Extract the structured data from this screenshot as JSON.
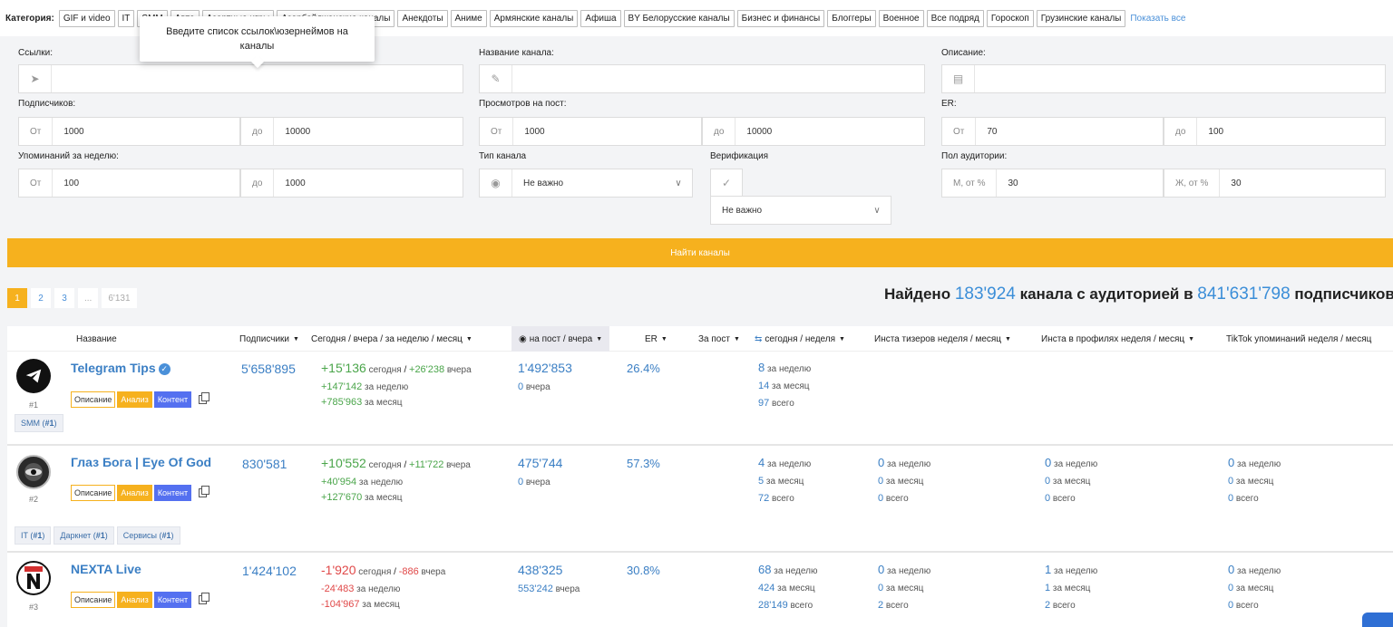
{
  "categories": {
    "label": "Категория:",
    "items": [
      "GIF и video",
      "IT",
      "SMM",
      "Авто",
      "Азартные игры",
      "Азербайджанские каналы",
      "Анекдоты",
      "Аниме",
      "Армянские каналы",
      "Афиша",
      "BY Белорусские каналы",
      "Бизнес и финансы",
      "Блоггеры",
      "Военное",
      "Все подряд",
      "Гороскоп",
      "Грузинские каналы"
    ],
    "show_all": "Показать все"
  },
  "tooltip": "Введите список ссылок\\юзернеймов на каналы",
  "filters": {
    "links_label": "Ссылки:",
    "name_label": "Название канала:",
    "desc_label": "Описание:",
    "subs_label": "Подписчиков:",
    "subs_from": "1000",
    "subs_to": "10000",
    "views_label": "Просмотров на пост:",
    "views_from": "1000",
    "views_to": "10000",
    "er_label": "ER:",
    "er_from": "70",
    "er_to": "100",
    "mentions_label": "Упоминаний за неделю:",
    "mentions_from": "100",
    "mentions_to": "1000",
    "type_label": "Тип канала",
    "type_value": "Не важно",
    "verif_label": "Верификация",
    "verif_value": "Не важно",
    "gender_label": "Пол аудитории:",
    "male_prefix": "М, от %",
    "male_value": "30",
    "female_prefix": "Ж, от %",
    "female_value": "30",
    "from": "От",
    "to": "до",
    "find_button": "Найти каналы"
  },
  "pagination": [
    "1",
    "2",
    "3",
    "...",
    "6'131"
  ],
  "found": {
    "prefix": "Найдено",
    "channels": "183'924",
    "middle": "канала с аудиторией в",
    "audience": "841'631'798",
    "suffix": "подписчиков"
  },
  "columns": {
    "name": "Название",
    "subs": "Подписчики",
    "growth": "Сегодня / вчера / за неделю / месяц",
    "views": "на пост / вчера",
    "er": "ER",
    "per_post": "За пост",
    "reposts": "сегодня / неделя",
    "insta_teasers": "Инста тизеров неделя / месяц",
    "insta_profiles": "Инста в профилях неделя / месяц",
    "tiktok": "TikTok упоминаний неделя / месяц"
  },
  "buttons": {
    "desc": "Описание",
    "analysis": "Анализ",
    "content": "Контент"
  },
  "words": {
    "today": "сегодня",
    "yesterday": "вчера",
    "per_week": "за неделю",
    "per_month": "за месяц",
    "total": "всего"
  },
  "rows": [
    {
      "name": "Telegram Tips",
      "rank": "#1",
      "subs": "5'658'895",
      "today": "+15'136",
      "yday": "+26'238",
      "week": "+147'142",
      "month": "+785'963",
      "views": "1'492'853",
      "views_yday": "0",
      "er": "26.4%",
      "rep_week": "8",
      "rep_month": "14",
      "rep_total": "97",
      "tags": [
        {
          "name": "SMM",
          "rank": "#1"
        }
      ]
    },
    {
      "name": "Глаз Бога | Eye Of God",
      "rank": "#2",
      "subs": "830'581",
      "today": "+10'552",
      "yday": "+11'722",
      "week": "+40'954",
      "month": "+127'670",
      "views": "475'744",
      "views_yday": "0",
      "er": "57.3%",
      "rep_week": "4",
      "rep_month": "5",
      "rep_total": "72",
      "it_week": "0",
      "it_month": "0",
      "it_total": "0",
      "ip_week": "0",
      "ip_month": "0",
      "ip_total": "0",
      "tt_week": "0",
      "tt_month": "0",
      "tt_total": "0",
      "tags": [
        {
          "name": "IT",
          "rank": "#1"
        },
        {
          "name": "Даркнет",
          "rank": "#1"
        },
        {
          "name": "Сервисы",
          "rank": "#1"
        }
      ]
    },
    {
      "name": "NEXTA Live",
      "rank": "#3",
      "subs": "1'424'102",
      "today": "-1'920",
      "yday": "-886",
      "week": "-24'483",
      "month": "-104'967",
      "views": "438'325",
      "views_yday": "553'242",
      "er": "30.8%",
      "rep_week": "68",
      "rep_month": "424",
      "rep_total": "28'149",
      "it_week": "0",
      "it_month": "0",
      "it_total": "2",
      "ip_week": "1",
      "ip_month": "1",
      "ip_total": "2",
      "tt_week": "0",
      "tt_month": "0",
      "tt_total": "0"
    }
  ]
}
